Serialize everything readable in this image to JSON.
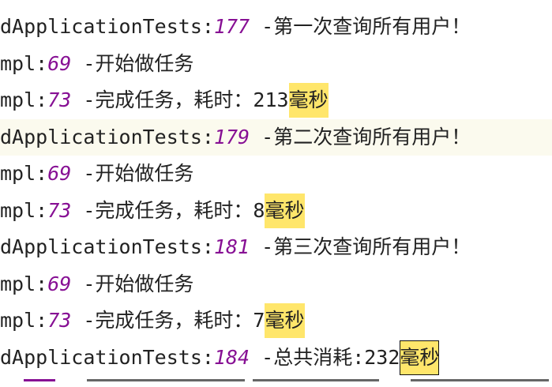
{
  "console": {
    "lines": [
      {
        "prefix": "dApplicationTests:",
        "line_no": "177",
        "message": " -第一次查询所有用户！",
        "highlight": ""
      },
      {
        "prefix": "mpl:",
        "line_no": "69",
        "message": " -开始做任务",
        "highlight": ""
      },
      {
        "prefix": "mpl:",
        "line_no": "73",
        "message": " -完成任务，耗时：213",
        "highlight": "毫秒"
      },
      {
        "prefix": "dApplicationTests:",
        "line_no": "179",
        "message": " -第二次查询所有用户！",
        "highlight": ""
      },
      {
        "prefix": "mpl:",
        "line_no": "69",
        "message": " -开始做任务",
        "highlight": ""
      },
      {
        "prefix": "mpl:",
        "line_no": "73",
        "message": " -完成任务，耗时：8",
        "highlight": "毫秒"
      },
      {
        "prefix": "dApplicationTests:",
        "line_no": "181",
        "message": " -第三次查询所有用户！",
        "highlight": ""
      },
      {
        "prefix": "mpl:",
        "line_no": "69",
        "message": " -开始做任务",
        "highlight": ""
      },
      {
        "prefix": "mpl:",
        "line_no": "73",
        "message": " -完成任务，耗时：7",
        "highlight": "毫秒"
      },
      {
        "prefix": "dApplicationTests:",
        "line_no": "184",
        "message": " -总共消耗:232",
        "highlight": "毫秒"
      }
    ],
    "current_line": 3,
    "selected_highlight_line": 9
  },
  "colors": {
    "background": "#ffffff",
    "text": "#222222",
    "line_number": "#871094",
    "search_highlight": "#ffe66b",
    "current_line": "#fbfaee"
  }
}
